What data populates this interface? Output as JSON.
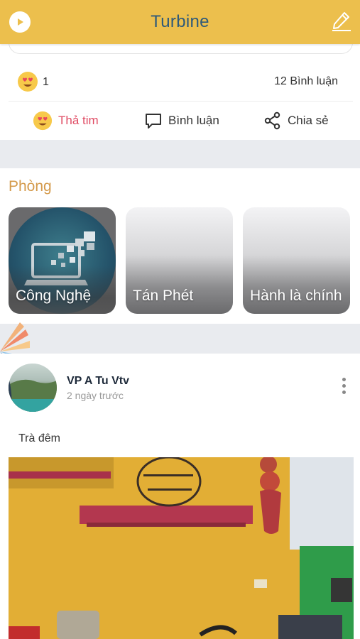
{
  "header": {
    "title": "Turbine",
    "left_icon": "play-circle-icon",
    "right_icon": "pencil-edit-icon"
  },
  "previous_post": {
    "reaction_emoji": "heart-eyes-emoji-icon",
    "reaction_count": "1",
    "comment_count_label": "12 Bình luận",
    "actions": {
      "like_label": "Thả tim",
      "comment_label": "Bình luận",
      "share_label": "Chia sẻ"
    }
  },
  "rooms": {
    "title": "Phòng",
    "items": [
      {
        "label": "Công Nghệ"
      },
      {
        "label": "Tán Phét"
      },
      {
        "label": "Hành là chính"
      }
    ]
  },
  "post": {
    "author": "VP A Tu Vtv",
    "time": "2 ngày trước",
    "text": "Trà đêm"
  },
  "colors": {
    "header_bg": "#ecbf4d",
    "title": "#2e5a7a",
    "like_accent": "#e04c64",
    "section_title": "#d49a4b",
    "band_bg": "#e9ebef"
  }
}
